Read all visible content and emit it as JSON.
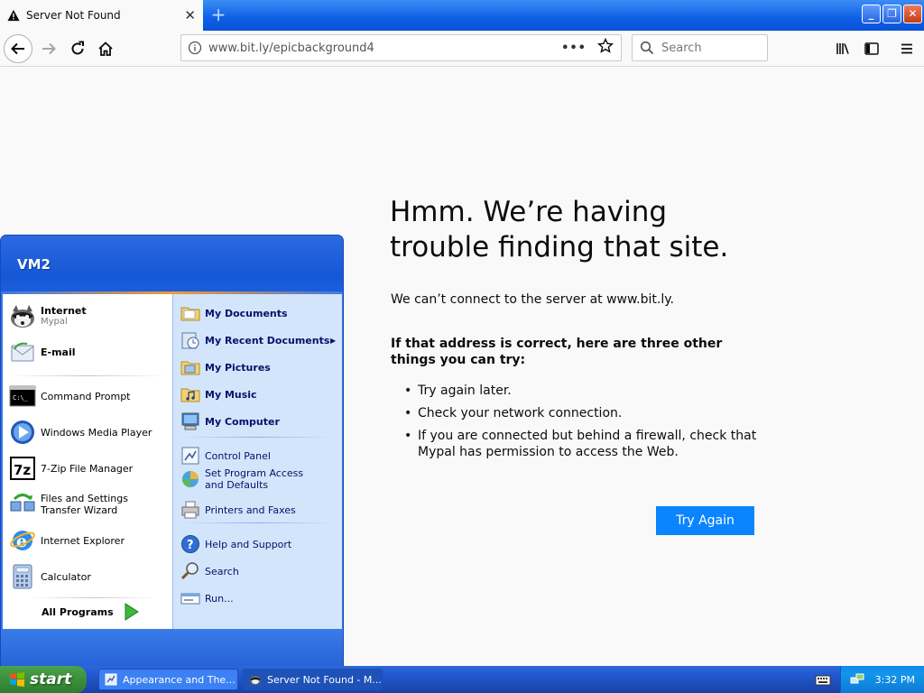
{
  "browser": {
    "tab_title": "Server Not Found",
    "url": "www.bit.ly/epicbackground4",
    "search_placeholder": "Search",
    "page_actions": "•••"
  },
  "error_page": {
    "title": "Hmm. We’re having trouble finding that site.",
    "description": "We can’t connect to the server at www.bit.ly.",
    "suggestion_heading": "If that address is correct, here are three other things you can try:",
    "suggestions": [
      "Try again later.",
      "Check your network connection.",
      "If you are connected but behind a firewall, check that Mypal has permission to access the Web."
    ],
    "try_again_label": "Try Again"
  },
  "start_menu": {
    "user_name": "VM2",
    "pinned": [
      {
        "label": "Internet",
        "sub": "Mypal",
        "icon": "mypal-icon"
      },
      {
        "label": "E-mail",
        "icon": "email-icon"
      }
    ],
    "recent": [
      {
        "label": "Command Prompt",
        "icon": "command-prompt-icon"
      },
      {
        "label": "Windows Media Player",
        "icon": "media-player-icon"
      },
      {
        "label": "7-Zip File Manager",
        "icon": "7zip-icon"
      },
      {
        "label": "Files and Settings Transfer Wizard",
        "icon": "transfer-wizard-icon"
      },
      {
        "label": "Internet Explorer",
        "icon": "internet-explorer-icon"
      },
      {
        "label": "Calculator",
        "icon": "calculator-icon"
      }
    ],
    "all_programs": "All Programs",
    "right": [
      {
        "label": "My Documents",
        "icon": "folder-icon"
      },
      {
        "label": "My Recent Documents",
        "icon": "recent-docs-icon"
      },
      {
        "label": "My Pictures",
        "icon": "folder-icon"
      },
      {
        "label": "My Music",
        "icon": "folder-icon"
      },
      {
        "label": "My Computer",
        "icon": "computer-icon"
      },
      {
        "label": "Control Panel",
        "icon": "control-panel-icon"
      },
      {
        "label": "Set Program Access and Defaults",
        "icon": "program-access-icon"
      },
      {
        "label": "Printers and Faxes",
        "icon": "printer-icon"
      },
      {
        "label": "Help and Support",
        "icon": "help-icon"
      },
      {
        "label": "Search",
        "icon": "search-icon"
      },
      {
        "label": "Run...",
        "icon": "run-icon"
      }
    ]
  },
  "taskbar": {
    "start_label": "start",
    "tasks": [
      {
        "label": "Appearance and The..."
      },
      {
        "label": "Server Not Found - M..."
      }
    ],
    "clock": "3:32 PM"
  }
}
